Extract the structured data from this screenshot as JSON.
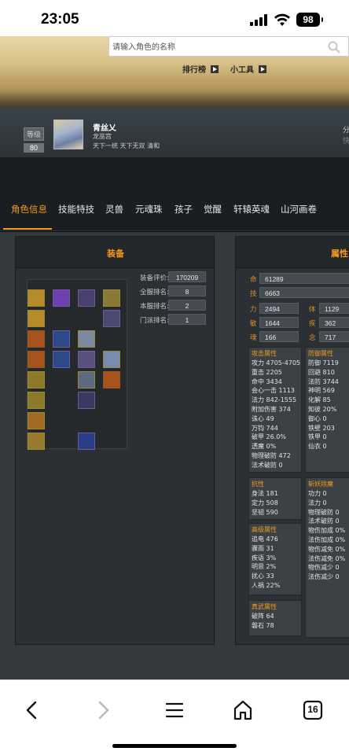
{
  "status_bar": {
    "time": "23:05",
    "battery": "98"
  },
  "search": {
    "placeholder": "请输入角色的名称"
  },
  "top_nav": {
    "ranking": "排行榜",
    "tools": "小工具"
  },
  "profile": {
    "level_label": "等级",
    "level": "80",
    "name": "青丝乂",
    "school": "龙巫宫",
    "server": "天下一统 天下无双 清和",
    "right_top": "分",
    "right_bottom": "快"
  },
  "tabs": [
    "角色信息",
    "技能特技",
    "灵兽",
    "元魂珠",
    "孩子",
    "觉醒",
    "轩辕英魂",
    "山河画卷"
  ],
  "equipment_panel": {
    "title": "装备",
    "ranks": [
      {
        "label": "装备评价:",
        "value": "170209"
      },
      {
        "label": "全服排名:",
        "value": "8"
      },
      {
        "label": "本服排名:",
        "value": "2"
      },
      {
        "label": "门派排名:",
        "value": "1"
      }
    ]
  },
  "attributes_panel": {
    "title": "属性",
    "base": {
      "ming_label": "命",
      "ming": "61289",
      "ji_label": "技",
      "ji": "6663",
      "li_label": "力",
      "li": "2494",
      "ti_label": "体",
      "ti": "1129",
      "min_label": "敏",
      "min": "1644",
      "ji2_label": "疾",
      "ji2": "362",
      "hun_label": "魂",
      "hun": "166",
      "nian_label": "念",
      "nian": "717"
    },
    "attack": {
      "title": "攻击属性",
      "lines": [
        "攻力 4705-4705",
        "重击 2205",
        "命中 3434",
        "会心一击 1113",
        "法力 842-1555",
        "附加伤害 374",
        "诛心 49",
        "万钧 744",
        "破甲 26.0%",
        "透魔 0%",
        "物理破防 472",
        "法术破防 0"
      ]
    },
    "defense": {
      "title": "防御属性",
      "lines": [
        "防御 7119",
        "回避 810",
        "法防 3744",
        "神明 569",
        "化解 85",
        "知彼 20%",
        "御心 0",
        "铁壁 203",
        "铁甲 0",
        "仙衣 0"
      ]
    },
    "resist": {
      "title": "抗性",
      "lines": [
        "身法 181",
        "定力 508",
        "坚韧 590"
      ]
    },
    "advanced": {
      "title": "高级属性",
      "lines": [
        "追电 476",
        "骤雨 31",
        "疾语 3%",
        "明思 2%",
        "扰心 33",
        "人祸 22%"
      ]
    },
    "demon": {
      "title": "斩妖除魔",
      "lines": [
        "功力 0",
        "法力 0",
        "物理破防 0",
        "法术破防 0",
        "物伤加成 0%",
        "法伤加成 0%",
        "物伤减免 0%",
        "法伤减免 0%",
        "物伤减少 0",
        "法伤减少 0"
      ]
    },
    "zhenwu": {
      "title": "真武属性",
      "lines": [
        "破阵 64",
        "磐石 78"
      ]
    }
  },
  "browser": {
    "tab_count": "16"
  }
}
